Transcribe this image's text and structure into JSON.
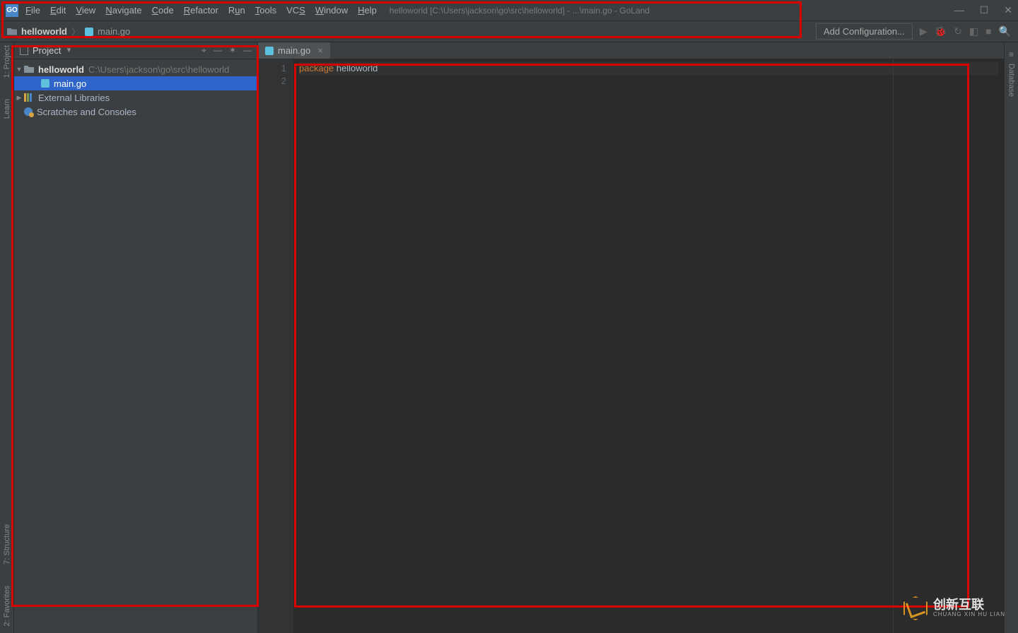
{
  "menu": {
    "file": "File",
    "edit": "Edit",
    "view": "View",
    "navigate": "Navigate",
    "code": "Code",
    "refactor": "Refactor",
    "run": "Run",
    "tools": "Tools",
    "vcs": "VCS",
    "window": "Window",
    "help": "Help"
  },
  "title": "helloworld [C:\\Users\\jackson\\go\\src\\helloworld] - ...\\main.go - GoLand",
  "breadcrumb": {
    "project": "helloworld",
    "file": "main.go"
  },
  "toolbar": {
    "add_config": "Add Configuration..."
  },
  "project_panel": {
    "title": "Project",
    "root": {
      "name": "helloworld",
      "path": "C:\\Users\\jackson\\go\\src\\helloworld"
    },
    "files": [
      {
        "name": "main.go"
      }
    ],
    "external": "External Libraries",
    "scratches": "Scratches and Consoles"
  },
  "left_tools": {
    "project": "1: Project",
    "learn": "Learn",
    "structure": "7: Structure",
    "favorites": "2: Favorites"
  },
  "right_tools": {
    "database": "Database"
  },
  "tabs": [
    {
      "name": "main.go"
    }
  ],
  "gutter": {
    "l1": "1",
    "l2": "2"
  },
  "code": {
    "keyword": "package",
    "ident": "helloworld"
  },
  "watermark": {
    "cn": "创新互联",
    "py": "CHUANG XIN HU LIAN"
  }
}
